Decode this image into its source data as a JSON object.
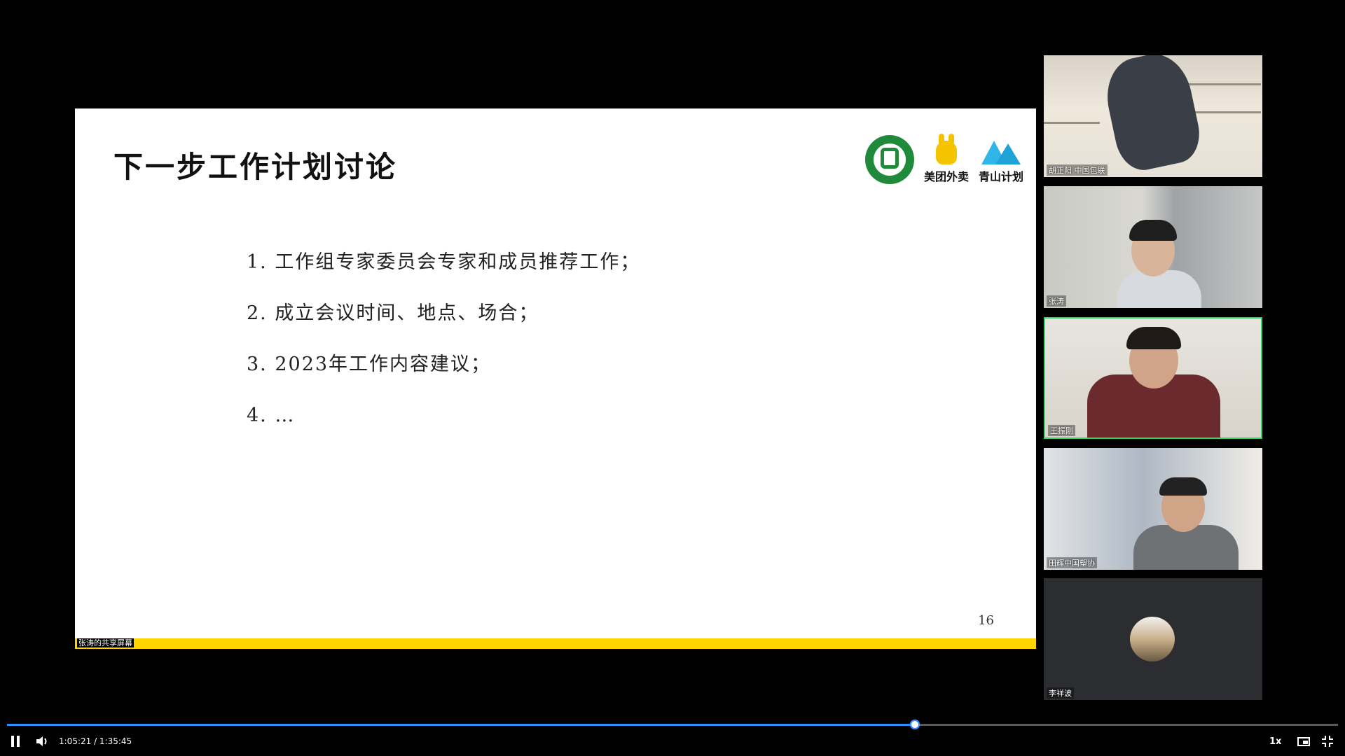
{
  "slide": {
    "title": "下一步工作计划讨论",
    "logos": {
      "brand1": "美团外卖",
      "brand2": "青山计划"
    },
    "items": [
      "1. 工作组专家委员会专家和成员推荐工作；",
      "2. 成立会议时间、地点、场合；",
      "3. 2023年工作内容建议；",
      "4. …"
    ],
    "page_number": "16",
    "share_label": "张涛的共享屏幕"
  },
  "participants": [
    {
      "name": "胡正阳 中国包联"
    },
    {
      "name": "张涛"
    },
    {
      "name": "王振刚",
      "active_speaker": true
    },
    {
      "name": "田辉中国塑协"
    },
    {
      "name": "李祥波"
    }
  ],
  "player": {
    "current_time": "1:05:21",
    "duration": "1:35:45",
    "time_display": "1:05:21 / 1:35:45",
    "progress_fraction": 0.682,
    "speed": "1x",
    "accent_color": "#2f8cff",
    "icons": [
      "pause-icon",
      "volume-icon",
      "picture-in-picture-icon",
      "exit-fullscreen-icon"
    ]
  }
}
